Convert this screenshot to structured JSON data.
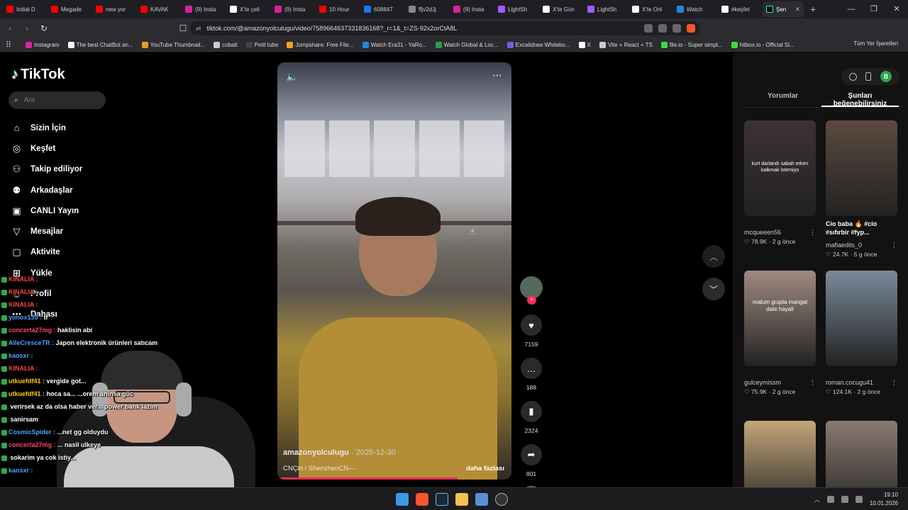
{
  "browser": {
    "tabs": [
      {
        "label": "Initial D",
        "color": "#ff0000"
      },
      {
        "label": "Megade",
        "color": "#ff0000"
      },
      {
        "label": "new yor",
        "color": "#ff0000"
      },
      {
        "label": "KAVAK",
        "color": "#ff0000"
      },
      {
        "label": "(9) Insta",
        "color": "#d6249f"
      },
      {
        "label": "X'te çeli",
        "color": "#ffffff"
      },
      {
        "label": "(9) Insta",
        "color": "#d6249f"
      },
      {
        "label": "10 Hour",
        "color": "#ff0000"
      },
      {
        "label": "608847",
        "color": "#1877f2"
      },
      {
        "label": "ffjv2dJj",
        "color": "#888888"
      },
      {
        "label": "(9) Insta",
        "color": "#d6249f"
      },
      {
        "label": "LightSh",
        "color": "#a05cff"
      },
      {
        "label": "X'te Gün",
        "color": "#ffffff"
      },
      {
        "label": "LightSh",
        "color": "#a05cff"
      },
      {
        "label": "X'te Onl",
        "color": "#ffffff"
      },
      {
        "label": "Watch",
        "color": "#1e88e5"
      },
      {
        "label": "#keşfet",
        "color": "#ffffff"
      }
    ],
    "active_tab": "Şen",
    "url": "tiktok.com/@amazonyolculugu/video/7589664637331836168?_r=1&_t=ZS-92x2orCtA8L",
    "bookmarks": [
      {
        "label": "Instagram",
        "color": "#d6249f"
      },
      {
        "label": "The best ChatBot an...",
        "color": "#ffffff"
      },
      {
        "label": "YouTube Thumbnail...",
        "color": "#e0a020"
      },
      {
        "label": "cobalt",
        "color": "#cccccc"
      },
      {
        "label": "Petit tube",
        "color": "#444444"
      },
      {
        "label": "Jumpshare: Free File...",
        "color": "#f0a020"
      },
      {
        "label": "Watch Era31 - YaRo...",
        "color": "#1e88e5"
      },
      {
        "label": "Watch Global & Loc...",
        "color": "#2e9e4e"
      },
      {
        "label": "Excalidraw Whitebo...",
        "color": "#6965db"
      },
      {
        "label": "X",
        "color": "#ffffff"
      },
      {
        "label": "Vite + React + TS",
        "color": "#cccccc"
      },
      {
        "label": "file.io - Super simpl...",
        "color": "#3ddc3d"
      },
      {
        "label": "hitbox.io - Official Si...",
        "color": "#3ddc3d"
      }
    ],
    "bookmarks_all": "Tüm Yer İşaretleri"
  },
  "sidebar": {
    "logo": "TikTok",
    "search_placeholder": "Ara",
    "items": [
      {
        "label": "Sizin İçin",
        "icon": "home-icon"
      },
      {
        "label": "Keşfet",
        "icon": "compass-icon"
      },
      {
        "label": "Takip ediliyor",
        "icon": "following-icon"
      },
      {
        "label": "Arkadaşlar",
        "icon": "friends-icon"
      },
      {
        "label": "CANLI Yayın",
        "icon": "live-icon"
      },
      {
        "label": "Mesajlar",
        "icon": "messages-icon"
      },
      {
        "label": "Aktivite",
        "icon": "activity-icon"
      },
      {
        "label": "Yükle",
        "icon": "upload-icon"
      },
      {
        "label": "Profil",
        "icon": "profile-icon"
      },
      {
        "label": "Dahası",
        "icon": "more-icon"
      }
    ]
  },
  "video": {
    "author": "amazonyolculugu",
    "date": "2025-12-30",
    "location": "CNÇin / ShenzhenCN—",
    "more_label": "daha fazlası",
    "progress_fraction": 0.77,
    "likes": "7159",
    "comments": "188",
    "saves": "2324",
    "shares": "801"
  },
  "right_panel": {
    "tabs": [
      "Yorumlar",
      "Şunları beğenebilirsiniz"
    ],
    "active_tab": 1,
    "cards": [
      {
        "caption": "kurt darlandı sabah erken kalkmak istemiyo",
        "title": "",
        "user": "mcqueeen56",
        "likes": "78.9K",
        "time": "2 g önce",
        "color": "#3c3236"
      },
      {
        "caption": "",
        "title": "Cio baba 🔥 #cio #sıfırbir #fyp...",
        "user": "mafiaedits_0",
        "likes": "24.7K",
        "time": "5 g önce",
        "color": "#5c4a40"
      },
      {
        "caption": "malum grupla mangal date hayali",
        "title": "",
        "user": "gulceymissm",
        "likes": "75.9K",
        "time": "2 g önce",
        "color": "#a08a80"
      },
      {
        "caption": "",
        "title": "",
        "user": "roman.cocugu41",
        "likes": "124.1K",
        "time": "2 g önce",
        "color": "#7a8a9a"
      },
      {
        "caption": "",
        "title": "",
        "user": "",
        "likes": "",
        "time": "",
        "color": "#c4a67a"
      },
      {
        "caption": "",
        "title": "",
        "user": "",
        "likes": "",
        "time": "",
        "color": "#8a7a70"
      }
    ]
  },
  "chat": [
    {
      "user": "KINALIA :",
      "msg": "",
      "color": "#ff4444"
    },
    {
      "user": "KINALIA :",
      "msg": "",
      "color": "#ff4444"
    },
    {
      "user": "KINALIA :",
      "msg": "",
      "color": "#ff4444"
    },
    {
      "user": "yunox135 :",
      "msg": "tr",
      "color": "#4aa3ff"
    },
    {
      "user": "concerta27mg :",
      "msg": "haklisin abi",
      "color": "#ff4466"
    },
    {
      "user": "AlleCresceTR :",
      "msg": "Japon elektronik ürünleri satıcam",
      "color": "#4aa3ff"
    },
    {
      "user": "kaosxr :",
      "msg": "",
      "color": "#4aa3ff"
    },
    {
      "user": "KINALIA :",
      "msg": "",
      "color": "#ff4444"
    },
    {
      "user": "utkuefdf41 :",
      "msg": "vergide got...",
      "color": "#ffcc00"
    },
    {
      "user": "utkuefdf41 :",
      "msg": "hoca sa... ...orem aninsa güc",
      "color": "#ffcc00"
    },
    {
      "user": "",
      "msg": "verirsek az da olsa haber ver... power bank lazim",
      "color": "#ffffff"
    },
    {
      "user": "",
      "msg": "sanirsam",
      "color": "#ffffff"
    },
    {
      "user": "CosmicSpider :",
      "msg": "...net gg olduydu",
      "color": "#4aa3ff"
    },
    {
      "user": "concerta27mg :",
      "msg": "... nasil ulkeye",
      "color": "#ff4466"
    },
    {
      "user": "",
      "msg": "sokarim ya cok istiy...",
      "color": "#ffffff"
    },
    {
      "user": "kaosxr :",
      "msg": "",
      "color": "#4aa3ff"
    }
  ],
  "taskbar": {
    "time": "19:10",
    "date": "10.01.2026"
  }
}
